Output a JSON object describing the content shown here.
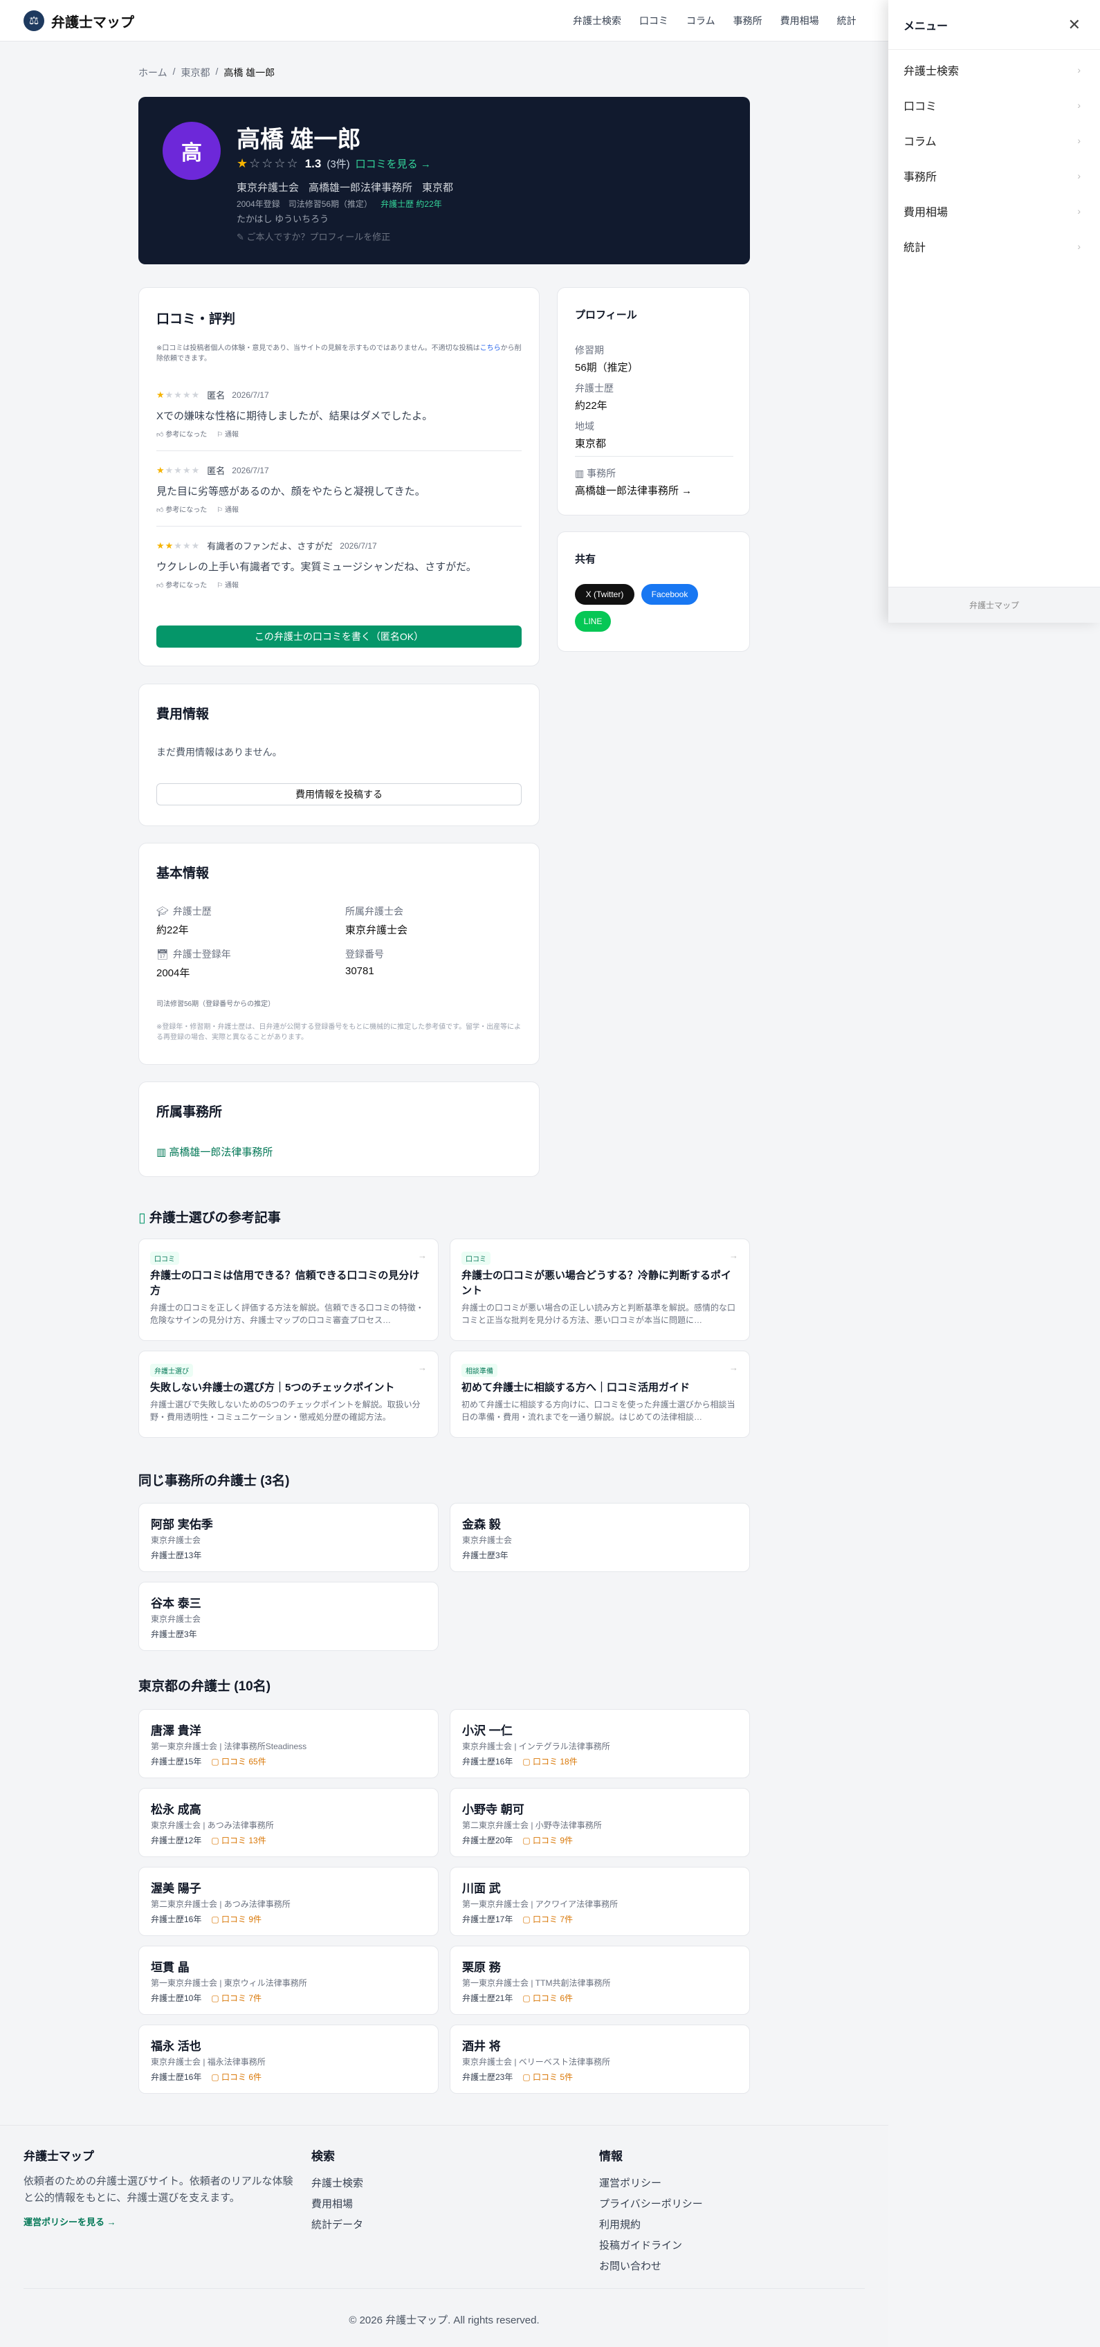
{
  "header": {
    "logo_mark": "⚖",
    "logo_text": "弁護士マップ",
    "nav": [
      "弁護士検索",
      "口コミ",
      "コラム",
      "事務所",
      "費用相場",
      "統計"
    ]
  },
  "drawer": {
    "title": "メニュー",
    "close": "✕",
    "items": [
      "弁護士検索",
      "口コミ",
      "コラム",
      "事務所",
      "費用相場",
      "統計"
    ],
    "footer": "弁護士マップ"
  },
  "breadcrumb": [
    "ホーム",
    "東京都",
    "高橋 雄一郎"
  ],
  "hero": {
    "avatar": "高",
    "name": "高橋 雄一郎",
    "stars_filled": 1,
    "stars_total": 5,
    "rating": "1.3",
    "rating_count": "(3件)",
    "rating_link": "口コミを見る →",
    "association": "東京弁護士会",
    "office": "高橋雄一郎法律事務所",
    "region": "東京都",
    "registered": "2004年登録",
    "term": "司法修習56期（推定）",
    "experience": "弁護士歴 約22年",
    "kana": "たかはし ゆういちろう",
    "claim": "ご本人ですか？プロフィールを修正"
  },
  "reviews_card": {
    "title": "口コミ・評判",
    "note_prefix": "※口コミは投稿者個人の体験・意見であり、当サイトの見解を示すものではありません。不適切な投稿は",
    "note_link": "こちら",
    "note_suffix": "から削除依頼できます。",
    "reviews": [
      {
        "stars": 1,
        "author": "匿名",
        "date": "2026/7/17",
        "text": "Xでの嫌味な性格に期待しましたが、結果はダメでしたよ。",
        "helpful": "参考になった",
        "report": "通報"
      },
      {
        "stars": 1,
        "author": "匿名",
        "date": "2026/7/17",
        "text": "見た目に劣等感があるのか、顔をやたらと凝視してきた。",
        "helpful": "参考になった",
        "report": "通報"
      },
      {
        "stars": 2,
        "author": "有識者のファンだよ、さすがだ",
        "date": "2026/7/17",
        "text": "ウクレレの上手い有識者です。実質ミュージシャンだね、さすがだ。",
        "helpful": "参考になった",
        "report": "通報"
      }
    ],
    "write_button": "この弁護士の口コミを書く（匿名OK）"
  },
  "fees_card": {
    "title": "費用情報",
    "empty": "まだ費用情報はありません。",
    "button": "費用情報を投稿する"
  },
  "basic_card": {
    "title": "基本情報",
    "items": [
      {
        "label": "弁護士歴",
        "value": "約22年"
      },
      {
        "label": "所属弁護士会",
        "value": "東京弁護士会"
      },
      {
        "label": "弁護士登録年",
        "value": "2004年"
      },
      {
        "label": "登録番号",
        "value": "30781"
      }
    ],
    "term_note": "司法修習56期（登録番号からの推定）",
    "disclaimer": "※登録年・修習期・弁護士歴は、日弁連が公開する登録番号をもとに機械的に推定した参考値です。留学・出産等による再登録の場合、実際と異なることがあります。"
  },
  "office_card": {
    "title": "所属事務所",
    "office": "高橋雄一郎法律事務所"
  },
  "profile_card": {
    "title": "プロフィール",
    "items": [
      {
        "label": "修習期",
        "value": "56期（推定）"
      },
      {
        "label": "弁護士歴",
        "value": "約22年"
      },
      {
        "label": "地域",
        "value": "東京都"
      }
    ],
    "office_label": "事務所",
    "office_link": "高橋雄一郎法律事務所 →"
  },
  "share_card": {
    "title": "共有",
    "x": "X (Twitter)",
    "facebook": "Facebook",
    "line": "LINE",
    "colors": {
      "x": "#111111",
      "facebook": "#1877f2",
      "line": "#06c755"
    }
  },
  "articles": {
    "title": "弁護士選びの参考記事",
    "items": [
      {
        "tag": "口コミ",
        "title": "弁護士の口コミは信用できる？信頼できる口コミの見分け方",
        "desc": "弁護士の口コミを正しく評価する方法を解説。信頼できる口コミの特徴・危険なサインの見分け方、弁護士マップの口コミ審査プロセス…"
      },
      {
        "tag": "口コミ",
        "title": "弁護士の口コミが悪い場合どうする？冷静に判断するポイント",
        "desc": "弁護士の口コミが悪い場合の正しい読み方と判断基準を解説。感情的な口コミと正当な批判を見分ける方法、悪い口コミが本当に問題に…"
      },
      {
        "tag": "弁護士選び",
        "title": "失敗しない弁護士の選び方｜5つのチェックポイント",
        "desc": "弁護士選びで失敗しないための5つのチェックポイントを解説。取扱い分野・費用透明性・コミュニケーション・懲戒処分歴の確認方法。"
      },
      {
        "tag": "相談準備",
        "title": "初めて弁護士に相談する方へ｜口コミ活用ガイド",
        "desc": "初めて弁護士に相談する方向けに、口コミを使った弁護士選びから相談当日の準備・費用・流れまでを一通り解説。はじめての法律相談…"
      }
    ]
  },
  "same_office": {
    "title": "同じ事務所の弁護士 (3名)",
    "items": [
      {
        "name": "阿部 実佑季",
        "firm": "東京弁護士会",
        "years": "弁護士歴13年",
        "reviews": ""
      },
      {
        "name": "金森 毅",
        "firm": "東京弁護士会",
        "years": "弁護士歴3年",
        "reviews": ""
      },
      {
        "name": "谷本 泰三",
        "firm": "東京弁護士会",
        "years": "弁護士歴3年",
        "reviews": ""
      }
    ]
  },
  "region_lawyers": {
    "title": "東京都の弁護士 (10名)",
    "items": [
      {
        "name": "唐澤 貴洋",
        "firm": "第一東京弁護士会 | 法律事務所Steadiness",
        "years": "弁護士歴15年",
        "reviews": "口コミ 65件"
      },
      {
        "name": "小沢 一仁",
        "firm": "東京弁護士会 | インテグラル法律事務所",
        "years": "弁護士歴16年",
        "reviews": "口コミ 18件"
      },
      {
        "name": "松永 成高",
        "firm": "東京弁護士会 | あつみ法律事務所",
        "years": "弁護士歴12年",
        "reviews": "口コミ 13件"
      },
      {
        "name": "小野寺 朝可",
        "firm": "第二東京弁護士会 | 小野寺法律事務所",
        "years": "弁護士歴20年",
        "reviews": "口コミ 9件"
      },
      {
        "name": "渥美 陽子",
        "firm": "第二東京弁護士会 | あつみ法律事務所",
        "years": "弁護士歴16年",
        "reviews": "口コミ 9件"
      },
      {
        "name": "川面 武",
        "firm": "第一東京弁護士会 | アクワイア法律事務所",
        "years": "弁護士歴17年",
        "reviews": "口コミ 7件"
      },
      {
        "name": "垣貫 晶",
        "firm": "第一東京弁護士会 | 東京ウィル法律事務所",
        "years": "弁護士歴10年",
        "reviews": "口コミ 7件"
      },
      {
        "name": "栗原 務",
        "firm": "第一東京弁護士会 | TTM共創法律事務所",
        "years": "弁護士歴21年",
        "reviews": "口コミ 6件"
      },
      {
        "name": "福永 活也",
        "firm": "東京弁護士会 | 福永法律事務所",
        "years": "弁護士歴16年",
        "reviews": "口コミ 6件"
      },
      {
        "name": "酒井 将",
        "firm": "東京弁護士会 | ベリーベスト法律事務所",
        "years": "弁護士歴23年",
        "reviews": "口コミ 5件"
      }
    ]
  },
  "footer": {
    "brand": "弁護士マップ",
    "desc": "依頼者のための弁護士選びサイト。依頼者のリアルな体験と公的情報をもとに、弁護士選びを支えます。",
    "policy_link": "運営ポリシーを見る →",
    "search_title": "検索",
    "search_items": [
      "弁護士検索",
      "費用相場",
      "統計データ"
    ],
    "info_title": "情報",
    "info_items": [
      "運営ポリシー",
      "プライバシーポリシー",
      "利用規約",
      "投稿ガイドライン",
      "お問い合わせ"
    ],
    "copyright": "© 2026 弁護士マップ. All rights reserved."
  }
}
